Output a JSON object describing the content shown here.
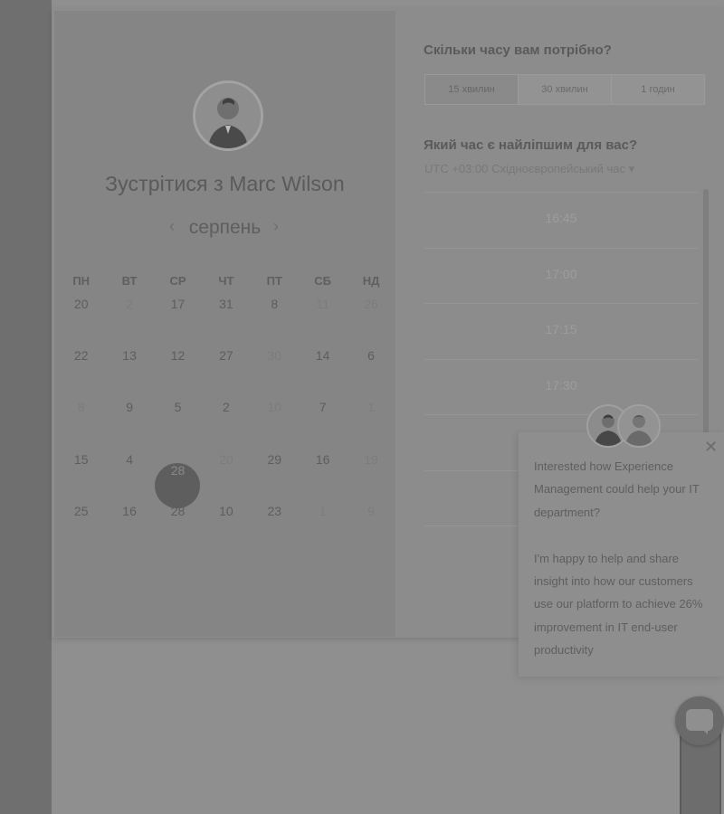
{
  "calendar": {
    "title": "Зустрітися з Marc Wilson",
    "month": "серпень",
    "prev_icon": "‹",
    "next_icon": "›",
    "weekdays": [
      "ПН",
      "ВТ",
      "СР",
      "ЧТ",
      "ПТ",
      "СБ",
      "НД"
    ],
    "days": [
      "20",
      "2",
      "17",
      "31",
      "8",
      "11",
      "26",
      "22",
      "13",
      "12",
      "27",
      "30",
      "14",
      "6",
      "8",
      "9",
      "5",
      "2",
      "10",
      "7",
      "1",
      "15",
      "4",
      "28",
      "20",
      "29",
      "16",
      "19",
      "25",
      "16",
      "28",
      "10",
      "23",
      "1",
      "9"
    ],
    "selected_day": "28"
  },
  "booking": {
    "duration_question": "Скільки часу вам потрібно?",
    "durations": [
      "15 хвилин",
      "30 хвилин",
      "1 годин"
    ],
    "active_duration": "15 хвилин",
    "time_question": "Який час є найліпшим для вас?",
    "timezone": "UTC +03:00 Східноєвропейський час ▾",
    "slots": [
      "16:45",
      "17:00",
      "17:15",
      "17:30",
      "",
      "",
      ""
    ]
  },
  "popup": {
    "close_icon": "✕",
    "paragraph1": "Interested how Experience Management could help your IT department?",
    "paragraph2": "I'm happy to help and share insight into how our customers use our platform to achieve 26% improvement in IT end-user productivity"
  },
  "colors": {
    "overlay": "#8f8f8f",
    "selected_day": "#5e5e5e"
  }
}
